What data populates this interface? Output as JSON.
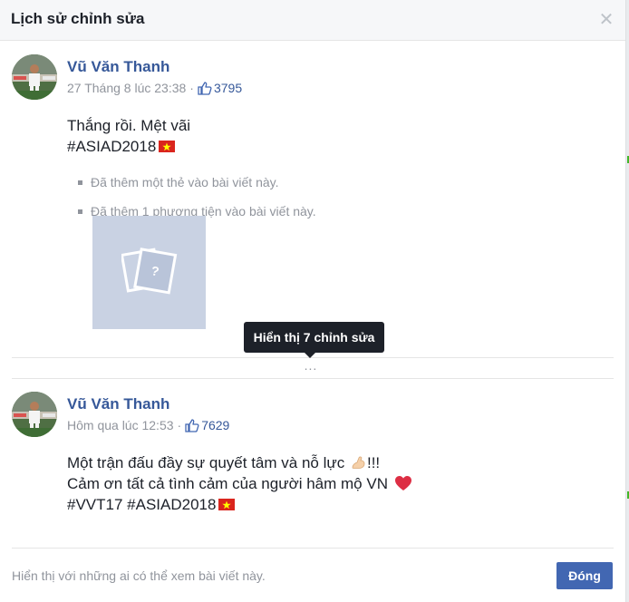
{
  "dialog": {
    "title": "Lịch sử chỉnh sửa",
    "close_icon": "close-icon"
  },
  "posts": [
    {
      "author": "Vũ Văn Thanh",
      "timestamp": "27 Tháng 8 lúc 23:38",
      "separator": "·",
      "like_count": "3795",
      "lines": [
        "Thắng rồi. Mệt vãi",
        "#ASIAD2018"
      ],
      "changes": [
        "Đã thêm một thẻ vào bài viết này.",
        "Đã thêm 1 phương tiện vào bài viết này."
      ]
    },
    {
      "author": "Vũ Văn Thanh",
      "timestamp": "Hôm qua lúc 12:53",
      "separator": "·",
      "like_count": "7629",
      "lines": [
        "Một trận đấu đầy sự quyết tâm và nỗ lực",
        "!!!",
        "Cảm ơn tất cả tình cảm của người hâm mộ VN",
        "#VVT17 #ASIAD2018"
      ]
    }
  ],
  "more": {
    "dots": "...",
    "tooltip": "Hiển thị 7 chỉnh sửa"
  },
  "footer": {
    "visibility_text": "Hiển thị với những ai có thể xem bài viết này.",
    "close_label": "Đóng"
  },
  "colors": {
    "link": "#365899",
    "button": "#4267b2",
    "muted": "#90949c",
    "flag_red": "#da251d",
    "flag_star": "#ffff00",
    "placeholder": "#c9d2e3"
  }
}
